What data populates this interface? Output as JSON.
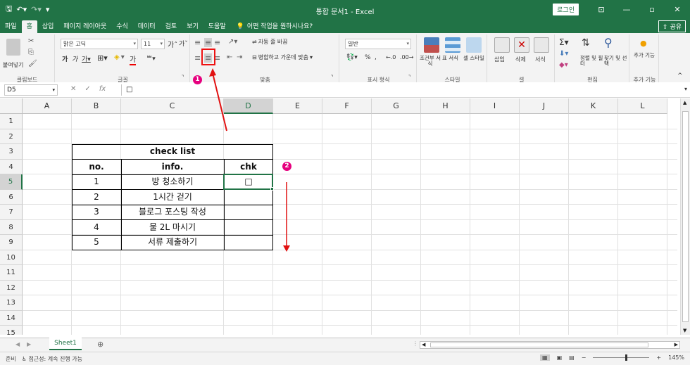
{
  "window": {
    "title": "통합 문서1 - Excel",
    "login_label": "로그인",
    "share_label": "공유"
  },
  "tabs": [
    {
      "label": "파일",
      "active": false
    },
    {
      "label": "홈",
      "active": true
    },
    {
      "label": "삽입",
      "active": false
    },
    {
      "label": "페이지 레이아웃",
      "active": false
    },
    {
      "label": "수식",
      "active": false
    },
    {
      "label": "데이터",
      "active": false
    },
    {
      "label": "검토",
      "active": false
    },
    {
      "label": "보기",
      "active": false
    },
    {
      "label": "도움말",
      "active": false
    }
  ],
  "tell_me": "어떤 작업을 원하시나요?",
  "ribbon": {
    "clipboard": {
      "label": "클립보드",
      "paste": "붙여넣기"
    },
    "font": {
      "label": "글꼴",
      "font_name": "맑은 고딕",
      "font_size": "11"
    },
    "alignment": {
      "label": "맞춤",
      "wrap_text": "자동 줄 바꿈",
      "merge_center": "병합하고 가운데 맞춤"
    },
    "number": {
      "label": "표시 형식",
      "format": "일반"
    },
    "styles": {
      "label": "스타일",
      "conditional": "조건부 서식",
      "table": "표 서식",
      "cell": "셀 스타일"
    },
    "cells": {
      "label": "셀",
      "insert": "삽입",
      "delete": "삭제",
      "format": "서식"
    },
    "editing": {
      "label": "편집",
      "sort": "정렬 및 필터",
      "find": "찾기 및 선택"
    },
    "addins": {
      "label": "추가 기능",
      "button": "추가 기능"
    }
  },
  "formula_bar": {
    "name_box": "D5",
    "content": "□"
  },
  "columns": [
    "A",
    "B",
    "C",
    "D",
    "E",
    "F",
    "G",
    "H",
    "I",
    "J",
    "K",
    "L"
  ],
  "rows": [
    "1",
    "2",
    "3",
    "4",
    "5",
    "6",
    "7",
    "8",
    "9",
    "10",
    "11",
    "12",
    "13",
    "14",
    "15"
  ],
  "table": {
    "title": "check list",
    "headers": [
      "no.",
      "info.",
      "chk"
    ],
    "rows": [
      [
        "1",
        "방 청소하기",
        "□"
      ],
      [
        "2",
        "1시간 걷기",
        ""
      ],
      [
        "3",
        "블로그 포스팅 작성",
        ""
      ],
      [
        "4",
        "물 2L 마시기",
        ""
      ],
      [
        "5",
        "서류 제출하기",
        ""
      ]
    ]
  },
  "sheets": [
    {
      "name": "Sheet1",
      "active": true
    }
  ],
  "status": {
    "ready": "준비",
    "accessibility": "접근성: 계속 진행 가능",
    "zoom": "145%"
  },
  "annotations": {
    "badge1": "1",
    "badge2": "2",
    "color": "#e6007e",
    "arrow_color": "#e11111"
  },
  "colors": {
    "excel_green": "#217346"
  }
}
